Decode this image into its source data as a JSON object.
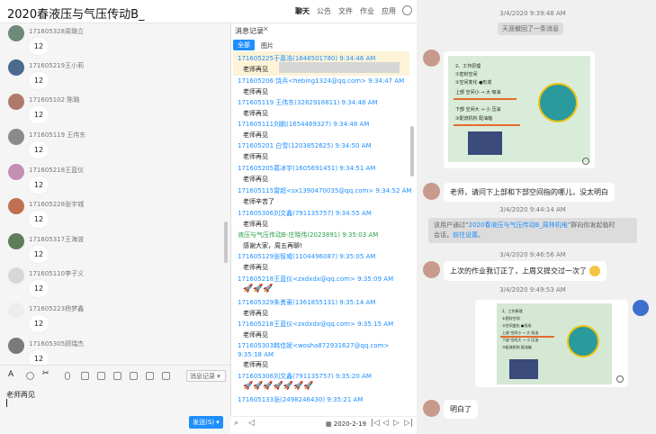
{
  "window": {
    "title": "2020春液压与气压传动B_"
  },
  "tabs": [
    {
      "label": "聊天"
    },
    {
      "label": "公告"
    },
    {
      "label": "文件"
    },
    {
      "label": "作业"
    },
    {
      "label": "应用"
    }
  ],
  "left_messages": [
    {
      "name": "171605328周璐立",
      "text": "12"
    },
    {
      "name": "171605219王小莉",
      "text": "12"
    },
    {
      "name": "171605102 陈璐",
      "text": "12"
    },
    {
      "name": "171605119 王伟东",
      "text": "12"
    },
    {
      "name": "171605218王蓝仪",
      "text": "12"
    },
    {
      "name": "171605228张宇城",
      "text": "12"
    },
    {
      "name": "171605317王海波",
      "text": "12"
    },
    {
      "name": "171605110李子义",
      "text": "12"
    },
    {
      "name": "171605223杨梦鑫",
      "text": "12"
    },
    {
      "name": "171605305顾瑞杰",
      "text": "12"
    }
  ],
  "toolbar": {
    "history_label": "消息记录"
  },
  "input": {
    "value": "老师再见"
  },
  "send": {
    "label": "发送(S)"
  },
  "history": {
    "title": "消息记录",
    "filter_all": "全部",
    "filter_pic": "图片",
    "entries": [
      {
        "head": "171605225于嘉浩(1848501780) 9:34:46 AM",
        "body": "老师再见"
      },
      {
        "head": "171605206 饶兵<hebing1324@qq.com> 9:34:47 AM",
        "body": "老师再见"
      },
      {
        "head": "171605119 王伟东(3282916811) 9:34:48 AM",
        "body": "老师再见"
      },
      {
        "head": "171605111刘鹏(1654469327) 9:34:48 AM",
        "body": "老师再见"
      },
      {
        "head": "171605201 白雪(1203852625) 9:34:50 AM",
        "body": "老师再见"
      },
      {
        "head": "171605205葛冰宇(1605691451) 9:34:51 AM",
        "body": "老师再见"
      },
      {
        "head": "171605115雷超<sx1390470035@qq.com> 9:34:52 AM",
        "body": "老师辛苦了"
      },
      {
        "head": "171605306刘文鑫(791135757) 9:34:55 AM",
        "body": "老师再见"
      },
      {
        "head": "液压与气压传动B-庄晓伟(2023891) 9:35:03 AM",
        "body": "感谢大家，周五再聊!"
      },
      {
        "head": "171605129张智威(1104496087) 9:35:05 AM",
        "body": "老师再见"
      },
      {
        "head": "171605218王蓝仪<zxdxdx@qq.com> 9:35:09 AM",
        "body": "🚀🚀🚀"
      },
      {
        "head": "171605329朱勇豪(1361855131) 9:35:14 AM",
        "body": "老师再见"
      },
      {
        "head": "171605218王蓝仪<zxdxdx@qq.com> 9:35:15 AM",
        "body": "老师再见"
      },
      {
        "head": "171605303韩佳妮<wosha872931627@qq.com> 9:35:18 AM",
        "body": "老师再见"
      },
      {
        "head": "171605306刘文鑫(791135757) 9:35:20 AM",
        "body": "🚀🚀🚀🚀🚀🚀🚀"
      },
      {
        "head": "171605133张(2498246430) 9:35:21 AM",
        "body": ""
      }
    ],
    "footer_date": "2020-2-19"
  },
  "right": {
    "time1": "3/4/2020 9:39:48 AM",
    "sys1": "天涯撤回了一条消息",
    "slide_lines": [
      "2、工作原理",
      "①密封空间",
      "②空间变化  ●形成",
      "上部   空间小 → 大  吸油",
      "下部   空间大 → 小  压油",
      "③配流机构   配油轴"
    ],
    "q1": "老师，请问下上部和下部空间指的哪儿，没太明白",
    "time2": "3/4/2020 9:44:14 AM",
    "sys2a": "该用户通过“",
    "sys2link": "2020春液压与气压传动B_周林机电",
    "sys2b": "”群向你发起临时",
    "sys2c": "会话，",
    "sys2settings": "前往设置",
    "sys2d": "。",
    "time3": "3/4/2020 9:46:56 AM",
    "q2": "上次的作业我订正了，上周又提交过一次了",
    "time4": "3/4/2020 9:49:53 AM",
    "slide2_lines": [
      "2、工作原理",
      "①密封空间",
      "②空间变化  ●形成",
      "上部  空间小 → 大  吸油",
      "下部  空间大 → 小  压油",
      "③配流机构  配油轴"
    ],
    "a1": "明白了"
  }
}
